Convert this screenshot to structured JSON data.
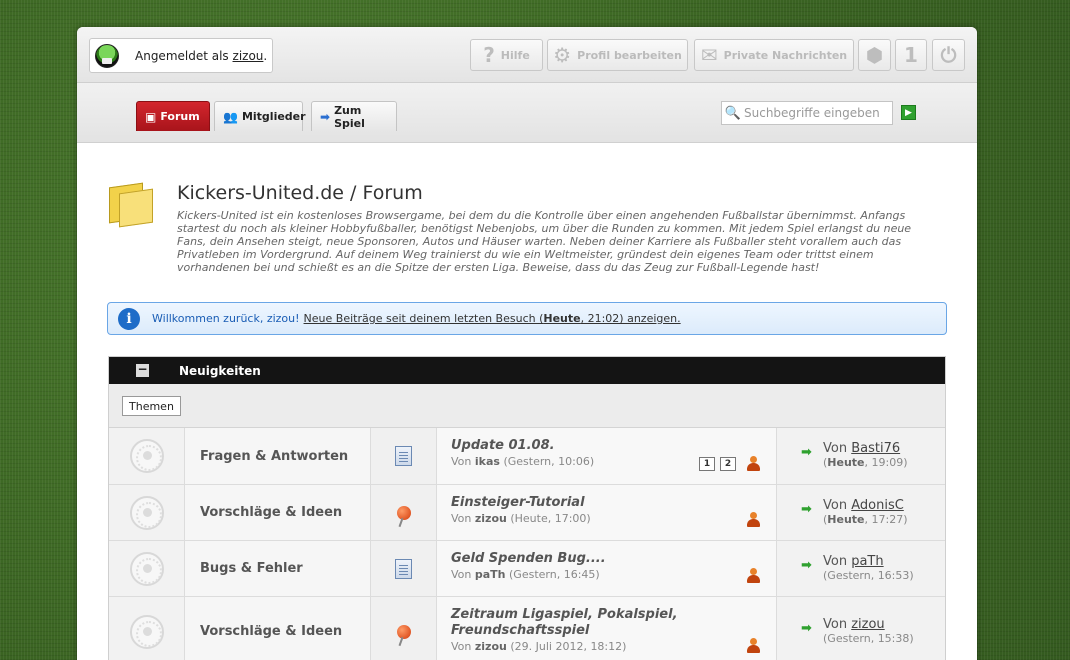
{
  "userbar": {
    "logged_in_prefix": "Angemeldet als",
    "username": "zizou",
    "logged_in_suffix": ".",
    "help_label": "Hilfe",
    "profile_label": "Profil bearbeiten",
    "messages_label": "Private Nachrichten",
    "count_label": "1"
  },
  "nav": {
    "tabs": [
      {
        "label": "Forum",
        "active": true
      },
      {
        "label": "Mitglieder",
        "active": false
      },
      {
        "label": "Zum Spiel",
        "active": false
      }
    ],
    "search_placeholder": "Suchbegriffe eingeben"
  },
  "header": {
    "title": "Kickers-United.de / Forum",
    "description": "Kickers-United ist ein kostenloses Browsergame, bei dem du die Kontrolle über einen angehenden Fußballstar übernimmst. Anfangs startest du noch als kleiner Hobbyfußballer, benötigst Nebenjobs, um über die Runden zu kommen. Mit jedem Spiel erlangst du neue Fans, dein Ansehen steigt, neue Sponsoren, Autos und Häuser warten. Neben deiner Karriere als Fußballer steht vorallem auch das Privatleben im Vordergrund. Auf deinem Weg trainierst du wie ein Weltmeister, gründest dein eigenes Team oder trittst einem vorhandenen bei und schießt es an die Spitze der ersten Liga. Beweise, dass du das Zeug zur Fußball-Legende hast!"
  },
  "welcome": {
    "greeting": "Willkommen zurück, zizou!",
    "link_prefix": "Neue Beiträge seit deinem letzten Besuch (",
    "link_day": "Heute",
    "link_suffix": ", 21:02) anzeigen."
  },
  "section": {
    "title": "Neuigkeiten",
    "collapse_symbol": "−",
    "themen_label": "Themen"
  },
  "rows": [
    {
      "board": "Fragen & Antworten",
      "icon": "document-icon",
      "topic": "Update 01.08.",
      "by_prefix": "Von",
      "author": "ikas",
      "time": "(Gestern, 10:06)",
      "pages": [
        "1",
        "2"
      ],
      "last_prefix": "Von",
      "last_user": "Basti76",
      "last_day": "Heute",
      "last_time": ", 19:09)"
    },
    {
      "board": "Vorschläge & Ideen",
      "icon": "pin-icon",
      "topic": "Einsteiger-Tutorial",
      "by_prefix": "Von",
      "author": "zizou",
      "time": "(Heute, 17:00)",
      "pages": [],
      "last_prefix": "Von",
      "last_user": "AdonisC",
      "last_day": "Heute",
      "last_time": ", 17:27)"
    },
    {
      "board": "Bugs & Fehler",
      "icon": "document-icon",
      "topic": "Geld Spenden Bug....",
      "by_prefix": "Von",
      "author": "paTh",
      "time": "(Gestern, 16:45)",
      "pages": [],
      "last_prefix": "Von",
      "last_user": "paTh",
      "last_day": "",
      "last_time": "(Gestern, 16:53)"
    },
    {
      "board": "Vorschläge & Ideen",
      "icon": "pin-icon",
      "topic": "Zeitraum Ligaspiel, Pokalspiel, Freundschaftsspiel",
      "by_prefix": "Von",
      "author": "zizou",
      "time": "(29. Juli 2012, 18:12)",
      "pages": [],
      "last_prefix": "Von",
      "last_user": "zizou",
      "last_day": "",
      "last_time": "(Gestern, 15:38)"
    }
  ]
}
